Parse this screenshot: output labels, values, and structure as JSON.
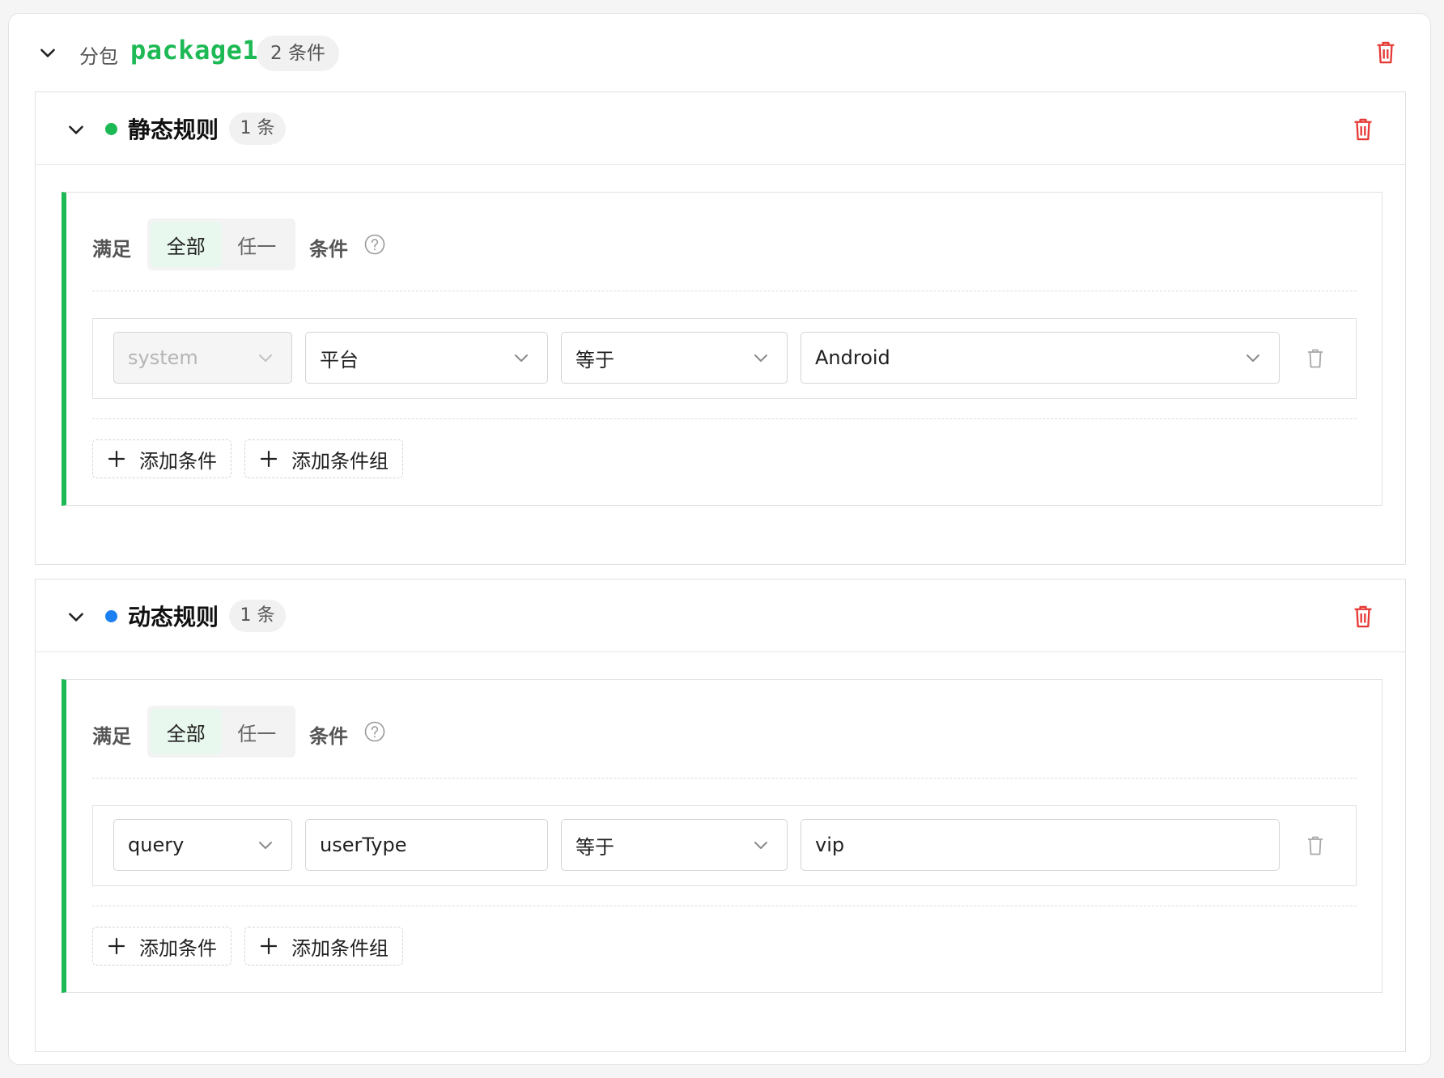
{
  "colors": {
    "brand_green": "#1db954",
    "danger_red": "#e53935",
    "dynamic_blue": "#1a7ff0"
  },
  "package": {
    "label": "分包",
    "name": "package1",
    "badge": "2 条件"
  },
  "static_rule": {
    "title": "静态规则",
    "badge": "1 条",
    "group": {
      "satisfy_label": "满足",
      "mode_all": "全部",
      "mode_any": "任一",
      "condition_label": "条件",
      "condition": {
        "source": "system",
        "field": "平台",
        "operator": "等于",
        "value": "Android"
      },
      "add_condition": "添加条件",
      "add_condition_group": "添加条件组"
    }
  },
  "dynamic_rule": {
    "title": "动态规则",
    "badge": "1 条",
    "group": {
      "satisfy_label": "满足",
      "mode_all": "全部",
      "mode_any": "任一",
      "condition_label": "条件",
      "condition": {
        "source": "query",
        "field": "userType",
        "operator": "等于",
        "value": "vip"
      },
      "add_condition": "添加条件",
      "add_condition_group": "添加条件组"
    }
  },
  "icons": {
    "collapse": "chevron-down-icon",
    "delete": "trash-icon",
    "help": "question-circle-icon",
    "add": "plus-icon",
    "dropdown": "chevron-down-icon"
  }
}
